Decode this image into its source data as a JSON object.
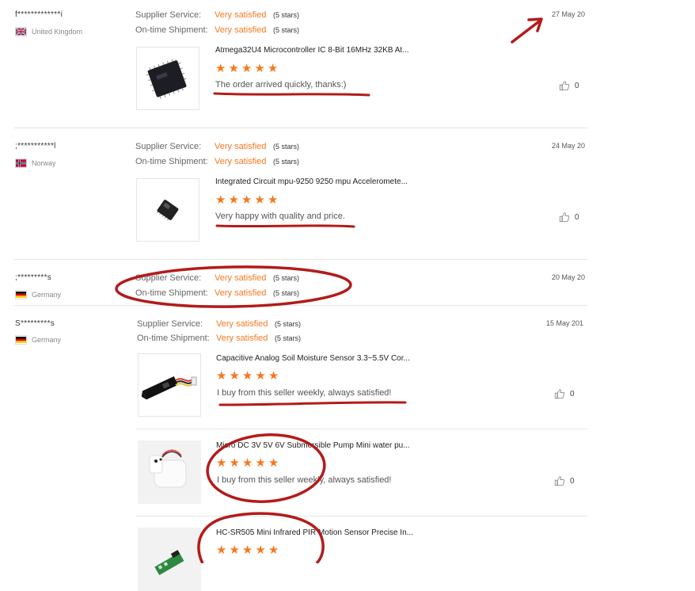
{
  "labels": {
    "supplier_service": "Supplier Service:",
    "ontime_shipment": "On-time Shipment:",
    "very_satisfied": "Very satisfied",
    "five_stars": "(5 stars)"
  },
  "icons": {
    "helpful": "thumbs-up-icon",
    "star": "star-icon"
  },
  "colors": {
    "accent": "#f47920",
    "annotation": "#b31b1b"
  },
  "reviews": [
    {
      "name": "f*************i",
      "country": "United Kingdom",
      "date": "27 May 20",
      "products": [
        {
          "title": "Atmega32U4 Microcontroller IC 8-Bit 16MHz 32KB At...",
          "rating": 5,
          "feedback": "The order arrived quickly, thanks:)",
          "helpful_count": "0"
        }
      ]
    },
    {
      "name": ";***********l",
      "country": "Norway",
      "date": "24 May 20",
      "products": [
        {
          "title": "Integrated Circuit mpu-9250 9250 mpu Acceleromete...",
          "rating": 5,
          "feedback": "Very happy with quality and price.",
          "helpful_count": "0"
        }
      ]
    },
    {
      "name": ";*********s",
      "country": "Germany",
      "date": "20 May 20",
      "products": []
    },
    {
      "name": "S*********s",
      "country": "Germany",
      "date": "15 May 201",
      "products": [
        {
          "title": "Capacitive Analog Soil Moisture Sensor 3.3~5.5V Cor...",
          "rating": 5,
          "feedback": "I buy from this seller weekly, always satisfied!",
          "helpful_count": "0"
        },
        {
          "title": "Micro DC 3V 5V 6V Submersible Pump Mini water pu...",
          "rating": 5,
          "feedback": "I buy from this seller weekly, always satisfied!",
          "helpful_count": "0"
        },
        {
          "title": "HC-SR505 Mini Infrared PIR Motion Sensor Precise In...",
          "rating": 5,
          "feedback": "",
          "helpful_count": ""
        }
      ]
    }
  ]
}
